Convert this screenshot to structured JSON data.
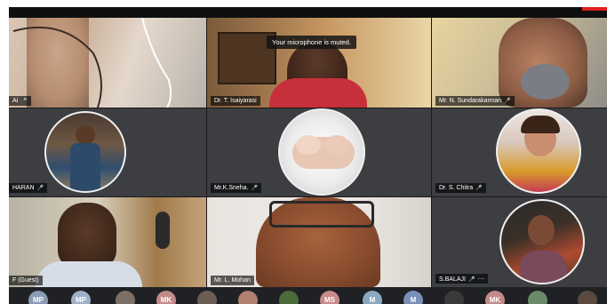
{
  "toast": "Your microphone is muted.",
  "participants": [
    {
      "name": "Ai",
      "video": true
    },
    {
      "name": "Dr. T. Isaiyarasi",
      "video": true
    },
    {
      "name": "Mr. N. Sundarakannan",
      "video": true
    },
    {
      "name": "HARAN",
      "video": false
    },
    {
      "name": "Mr.K.Sneha.",
      "video": false
    },
    {
      "name": "Dr. S. Chitra",
      "video": false
    },
    {
      "name": "F (Guest)",
      "video": true
    },
    {
      "name": "Mr. L. Mohan",
      "video": true
    },
    {
      "name": "S.BALAJI",
      "video": false
    }
  ],
  "more_icon": "···",
  "thumbnails": [
    {
      "initials": "MP",
      "color": "#8a9bb5"
    },
    {
      "initials": "MP",
      "color": "#9fb0c8"
    },
    {
      "initials": "",
      "color": "#7d7067"
    },
    {
      "initials": "MK",
      "color": "#c48a8a"
    },
    {
      "initials": "",
      "color": "#6a5e55"
    },
    {
      "initials": "",
      "color": "#b08070"
    },
    {
      "initials": "",
      "color": "#4d6b3a"
    },
    {
      "initials": "MS",
      "color": "#c88a8a"
    },
    {
      "initials": "M",
      "color": "#8aa8c0"
    },
    {
      "initials": "M",
      "color": "#7a8fb8"
    },
    {
      "initials": "",
      "color": "#3a3a3a"
    },
    {
      "initials": "MK",
      "color": "#c48a8a"
    },
    {
      "initials": "",
      "color": "#6a8a6a"
    },
    {
      "initials": "",
      "color": "#5a4a40"
    }
  ],
  "colors": {
    "tile_gray": "#3c3e42",
    "highlight": "#e02020"
  }
}
